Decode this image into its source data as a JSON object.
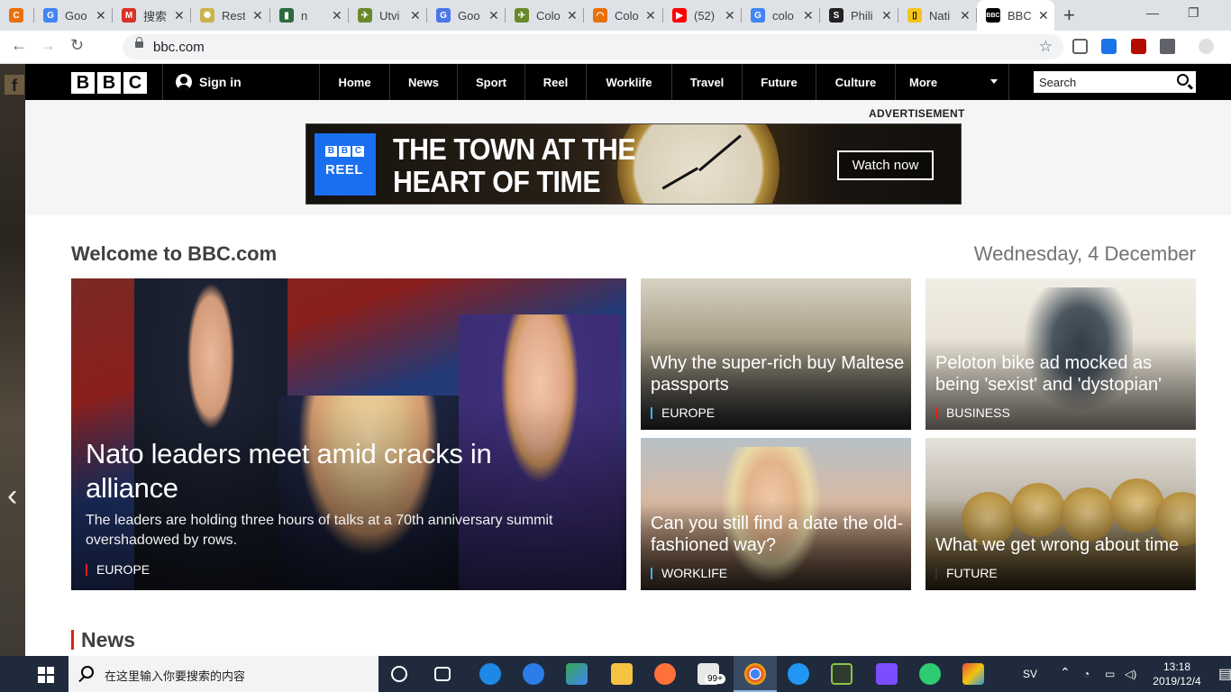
{
  "browser": {
    "tabs": [
      {
        "title": "",
        "favicon_color": "#e8710a",
        "favicon_glyph": "C"
      },
      {
        "title": "Goo",
        "favicon_color": "#4285f4",
        "favicon_glyph": "G"
      },
      {
        "title": "搜索",
        "favicon_color": "#d93025",
        "favicon_glyph": "M"
      },
      {
        "title": "Rest",
        "favicon_color": "#c9b44a",
        "favicon_glyph": "✺"
      },
      {
        "title": "n",
        "favicon_color": "#2d6a3e",
        "favicon_glyph": "▮"
      },
      {
        "title": "Utvi",
        "favicon_color": "#6a8a2a",
        "favicon_glyph": "✈"
      },
      {
        "title": "Goo",
        "favicon_color": "#4a76e8",
        "favicon_glyph": "G"
      },
      {
        "title": "Colo",
        "favicon_color": "#6a8a2a",
        "favicon_glyph": "✈"
      },
      {
        "title": "Colo",
        "favicon_color": "#e8710a",
        "favicon_glyph": "◠"
      },
      {
        "title": "(52)",
        "favicon_color": "#ff0000",
        "favicon_glyph": "▶"
      },
      {
        "title": "colo",
        "favicon_color": "#4285f4",
        "favicon_glyph": "G"
      },
      {
        "title": "Phili",
        "favicon_color": "#222222",
        "favicon_glyph": "S"
      },
      {
        "title": "Nati",
        "favicon_color": "#f5c518",
        "favicon_glyph": "▯"
      },
      {
        "title": "BBC",
        "favicon_color": "#000000",
        "favicon_glyph": "B"
      }
    ],
    "url": "bbc.com",
    "new_tab_label": "+"
  },
  "nav": {
    "logo_letters": [
      "B",
      "B",
      "C"
    ],
    "signin": "Sign in",
    "items": [
      "Home",
      "News",
      "Sport",
      "Reel",
      "Worklife",
      "Travel",
      "Future",
      "Culture"
    ],
    "more": "More",
    "search_placeholder": "Search"
  },
  "ad": {
    "label": "ADVERTISEMENT",
    "brand_letters": [
      "B",
      "B",
      "C"
    ],
    "brand": "REEL",
    "headline_line1": "THE TOWN AT THE",
    "headline_line2": "HEART OF TIME",
    "cta": "Watch now"
  },
  "welcome": "Welcome to BBC.com",
  "date": "Wednesday, 4 December",
  "hero": {
    "title": "Nato leaders meet amid cracks in alliance",
    "summary": "The leaders are holding three hours of talks at a 70th anniversary summit overshadowed by rows.",
    "tag": "EUROPE"
  },
  "cards": [
    {
      "title": "Why the super-rich buy Maltese passports",
      "tag": "EUROPE"
    },
    {
      "title": "Peloton bike ad mocked as being 'sexist' and 'dystopian'",
      "tag": "BUSINESS"
    },
    {
      "title": "Can you still find a date the old-fashioned way?",
      "tag": "WORKLIFE"
    },
    {
      "title": "What we get wrong about time",
      "tag": "FUTURE"
    }
  ],
  "section_news": "News",
  "taskbar": {
    "search_placeholder": "在这里输入你要搜索的内容",
    "badge": "99+",
    "lang": "SV",
    "time": "13:18",
    "date": "2019/12/4"
  }
}
